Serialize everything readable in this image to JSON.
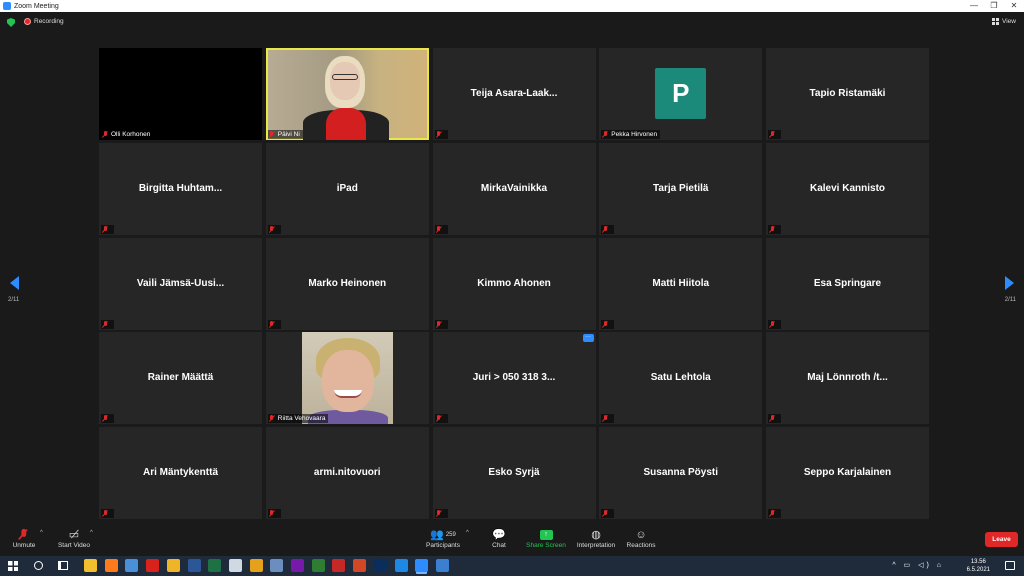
{
  "window": {
    "title": "Zoom Meeting",
    "min": "—",
    "max": "❐",
    "close": "✕"
  },
  "topbar": {
    "recording_label": "Recording",
    "view_label": "View"
  },
  "paging": {
    "left": "2/11",
    "right": "2/11"
  },
  "tiles": [
    {
      "name": "Olli Korhonen",
      "kind": "video-off-black"
    },
    {
      "name": "Päivi Ni",
      "kind": "video-1"
    },
    {
      "name": "Teija  Asara-Laak...",
      "kind": "name"
    },
    {
      "name": "Pekka Hirvonen",
      "kind": "avatar",
      "initial": "P"
    },
    {
      "name": "Tapio Ristamäki",
      "kind": "name"
    },
    {
      "name": "Birgitta  Huhtam...",
      "kind": "name"
    },
    {
      "name": "iPad",
      "kind": "name"
    },
    {
      "name": "MirkaVainikka",
      "kind": "name"
    },
    {
      "name": "Tarja Pietilä",
      "kind": "name"
    },
    {
      "name": "Kalevi Kannisto",
      "kind": "name"
    },
    {
      "name": "Vaili  Jämsä-Uusi...",
      "kind": "name"
    },
    {
      "name": "Marko Heinonen",
      "kind": "name"
    },
    {
      "name": "Kimmo Ahonen",
      "kind": "name"
    },
    {
      "name": "Matti Hiitola",
      "kind": "name"
    },
    {
      "name": "Esa Springare",
      "kind": "name"
    },
    {
      "name": "Rainer Määttä",
      "kind": "name"
    },
    {
      "name": "Riitta Vehovaara",
      "kind": "video-2"
    },
    {
      "name": "Juri > 050 318 3...",
      "kind": "name",
      "more": "···"
    },
    {
      "name": "Satu Lehtola",
      "kind": "name"
    },
    {
      "name": "Maj  Lönnroth /t...",
      "kind": "name"
    },
    {
      "name": "Ari Mäntykenttä",
      "kind": "name"
    },
    {
      "name": "armi.nitovuori",
      "kind": "name"
    },
    {
      "name": "Esko Syrjä",
      "kind": "name"
    },
    {
      "name": "Susanna Pöysti",
      "kind": "name"
    },
    {
      "name": "Seppo Karjalainen",
      "kind": "name"
    }
  ],
  "toolbar": {
    "unmute": "Unmute",
    "start_video": "Start Video",
    "participants": "Participants",
    "participants_count": "259",
    "chat": "Chat",
    "share_screen": "Share Screen",
    "interpretation": "Interpretation",
    "reactions": "Reactions",
    "leave": "Leave",
    "caret": "^"
  },
  "taskbar": {
    "time": "13.56",
    "date": "6.5.2021",
    "tray": "^ ▭ ◁) ⌂",
    "apps": [
      {
        "name": "file-explorer",
        "color": "#f2c02e"
      },
      {
        "name": "firefox",
        "color": "#ff7a1a"
      },
      {
        "name": "notepad",
        "color": "#4a90d9"
      },
      {
        "name": "acrobat",
        "color": "#d9221c"
      },
      {
        "name": "outlook",
        "color": "#f0b429"
      },
      {
        "name": "word",
        "color": "#2b5797"
      },
      {
        "name": "excel",
        "color": "#1e7145"
      },
      {
        "name": "paint",
        "color": "#cfd8e3"
      },
      {
        "name": "chrome",
        "color": "#e5a11c"
      },
      {
        "name": "calculator",
        "color": "#6c8ebf"
      },
      {
        "name": "onenote",
        "color": "#7719aa"
      },
      {
        "name": "scrivener",
        "color": "#2e7d32"
      },
      {
        "name": "tool-red",
        "color": "#c62828"
      },
      {
        "name": "powerpoint",
        "color": "#d24726"
      },
      {
        "name": "photoshop",
        "color": "#0b2d5c"
      },
      {
        "name": "edge",
        "color": "#1e88e5"
      },
      {
        "name": "zoom",
        "color": "#2d8cff"
      },
      {
        "name": "photos",
        "color": "#3c7fd0"
      }
    ]
  }
}
